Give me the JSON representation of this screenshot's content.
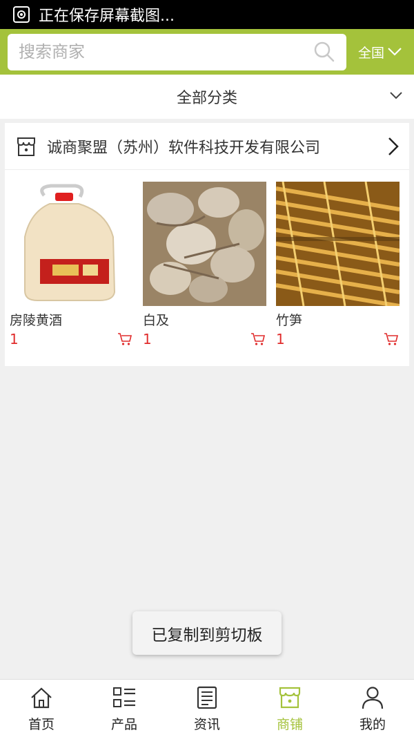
{
  "status_bar": {
    "text": "正在保存屏幕截图..."
  },
  "search": {
    "placeholder": "搜索商家",
    "region_label": "全国"
  },
  "category": {
    "label": "全部分类"
  },
  "shop": {
    "name": "诚商聚盟（苏州）软件科技开发有限公司",
    "products": [
      {
        "name": "房陵黄酒",
        "price": "1",
        "image": "yellow-wine-jug"
      },
      {
        "name": "白及",
        "price": "1",
        "image": "dried-bletilla-tubers"
      },
      {
        "name": "竹笋",
        "price": "1",
        "image": "dried-bamboo-shoots"
      }
    ]
  },
  "toast": {
    "text": "已复制到剪切板"
  },
  "nav": {
    "items": [
      {
        "label": "首页",
        "icon": "home-icon"
      },
      {
        "label": "产品",
        "icon": "product-list-icon"
      },
      {
        "label": "资讯",
        "icon": "news-icon"
      },
      {
        "label": "商铺",
        "icon": "store-icon",
        "active": true
      },
      {
        "label": "我的",
        "icon": "user-icon"
      }
    ]
  },
  "colors": {
    "accent": "#a4c23b",
    "price": "#e02b2b",
    "status_bar": "#000000"
  }
}
